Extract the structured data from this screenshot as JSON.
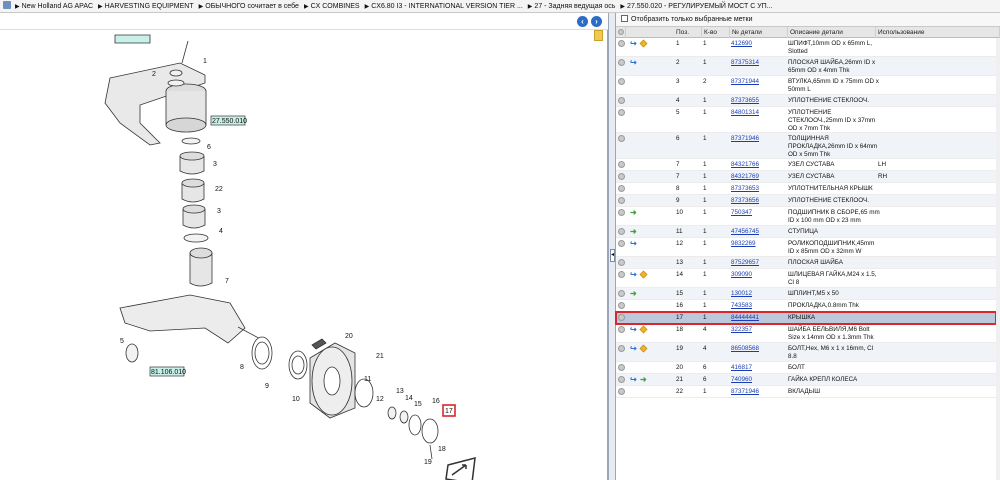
{
  "breadcrumb": [
    "New Holland AG APAC",
    "HARVESTING EQUIPMENT",
    "ОБЫЧНОГО сочитает в себе",
    "CX COMBINES",
    "CX6.80 I3 - INTERNATIONAL VERSION TIER ...",
    "27 - Задняя ведущая ось",
    "27.550.020 - РЕГУЛИРУЕМЫЙ МОСТ С УП..."
  ],
  "diagram": {
    "refs": [
      "27.550.010",
      "81.106.010"
    ],
    "callouts": [
      "1",
      "2",
      "3",
      "3",
      "4",
      "5",
      "6",
      "7",
      "8",
      "9",
      "10",
      "11",
      "12",
      "13",
      "14",
      "15",
      "16",
      "17",
      "18",
      "19",
      "20",
      "21",
      "22"
    ],
    "selected_callout": "17"
  },
  "filter": {
    "label": "Отобразить только выбранные метки"
  },
  "columns": {
    "pos": "Поз.",
    "qty": "К-во",
    "part": "№ детали",
    "desc": "Описание детали",
    "use": "Использование"
  },
  "rows": [
    {
      "pos": "1",
      "qty": "1",
      "part": "412690",
      "desc": "ШПИФТ,10mm OD x 65mm L, Slotted",
      "use": "",
      "icons": [
        "info",
        "box"
      ]
    },
    {
      "pos": "2",
      "qty": "1",
      "part": "87375314",
      "desc": "ПЛОСКАЯ ШАЙБА,26mm ID x 65mm OD x 4mm Thk",
      "use": "",
      "icons": [
        "info"
      ]
    },
    {
      "pos": "3",
      "qty": "2",
      "part": "87371944",
      "desc": "ВТУЛКА,65mm ID x 75mm OD x 50mm L",
      "use": "",
      "icons": []
    },
    {
      "pos": "4",
      "qty": "1",
      "part": "87373655",
      "desc": "УПЛОТНЕНИЕ СТЕКЛООЧ.",
      "use": "",
      "icons": []
    },
    {
      "pos": "5",
      "qty": "1",
      "part": "84801314",
      "desc": "УПЛОТНЕНИЕ СТЕКЛООЧ.,25mm ID x 37mm OD x 7mm Thk",
      "use": "",
      "icons": []
    },
    {
      "pos": "6",
      "qty": "1",
      "part": "87371946",
      "desc": "ТОЛЩИННАЯ ПРОКЛАДКА,26mm ID x 64mm OD x 5mm Thk",
      "use": "",
      "icons": []
    },
    {
      "pos": "7",
      "qty": "1",
      "part": "84321766",
      "desc": "УЗЕЛ СУСТАВА",
      "use": "LH",
      "icons": []
    },
    {
      "pos": "7",
      "qty": "1",
      "part": "84321769",
      "desc": "УЗЕЛ СУСТАВА",
      "use": "RH",
      "icons": []
    },
    {
      "pos": "8",
      "qty": "1",
      "part": "87373653",
      "desc": "УПЛОТНИТЕЛЬНАЯ КРЫШК",
      "use": "",
      "icons": []
    },
    {
      "pos": "9",
      "qty": "1",
      "part": "87373656",
      "desc": "УПЛОТНЕНИЕ СТЕКЛООЧ.",
      "use": "",
      "icons": []
    },
    {
      "pos": "10",
      "qty": "1",
      "part": "750347",
      "desc": "ПОДШИПНИК В СБОРЕ,65 mm ID x 100 mm OD x 23 mm",
      "use": "",
      "icons": [
        "arrow"
      ]
    },
    {
      "pos": "11",
      "qty": "1",
      "part": "47456745",
      "desc": "СТУПИЦА",
      "use": "",
      "icons": [
        "arrow"
      ]
    },
    {
      "pos": "12",
      "qty": "1",
      "part": "9832269",
      "desc": "РОЛИКОПОДШИПНИК,45mm ID x 85mm OD x 32mm W",
      "use": "",
      "icons": [
        "info"
      ]
    },
    {
      "pos": "13",
      "qty": "1",
      "part": "87529657",
      "desc": "ПЛОСКАЯ ШАЙБА",
      "use": "",
      "icons": []
    },
    {
      "pos": "14",
      "qty": "1",
      "part": "309090",
      "desc": "ШЛИЦЕВАЯ ГАЙКА,M24 x 1.5, Cl 8",
      "use": "",
      "icons": [
        "info",
        "box"
      ]
    },
    {
      "pos": "15",
      "qty": "1",
      "part": "130012",
      "desc": "ШПЛИНТ,M5 x 50",
      "use": "",
      "icons": [
        "arrow"
      ]
    },
    {
      "pos": "16",
      "qty": "1",
      "part": "743583",
      "desc": "ПРОКЛАДКА,0.8mm Thk",
      "use": "",
      "icons": []
    },
    {
      "pos": "17",
      "qty": "1",
      "part": "84444441",
      "desc": "КРЫШКА",
      "use": "",
      "icons": [],
      "selected": true
    },
    {
      "pos": "18",
      "qty": "4",
      "part": "322357",
      "desc": "ШАЙБА БЕЛЬВИЛЯ,M6 Bolt Size x 14mm OD x 1.3mm Thk",
      "use": "",
      "icons": [
        "info",
        "box"
      ]
    },
    {
      "pos": "19",
      "qty": "4",
      "part": "86508568",
      "desc": "БОЛТ,Hex, M6 x 1 x 16mm, Cl 8.8",
      "use": "",
      "icons": [
        "info",
        "box"
      ]
    },
    {
      "pos": "20",
      "qty": "6",
      "part": "416817",
      "desc": "БОЛТ",
      "use": "",
      "icons": []
    },
    {
      "pos": "21",
      "qty": "6",
      "part": "740960",
      "desc": "ГАЙКА КРЕПЛ КОЛЕСА",
      "use": "",
      "icons": [
        "info",
        "arrow2"
      ]
    },
    {
      "pos": "22",
      "qty": "1",
      "part": "87371946",
      "desc": "ВКЛАДЫШ",
      "use": "",
      "icons": []
    }
  ],
  "colors": {
    "selected_row": "#bcc8db",
    "highlight_border": "#d9262b",
    "link": "#1a3db5",
    "ref_box": "#c9f0e8"
  }
}
